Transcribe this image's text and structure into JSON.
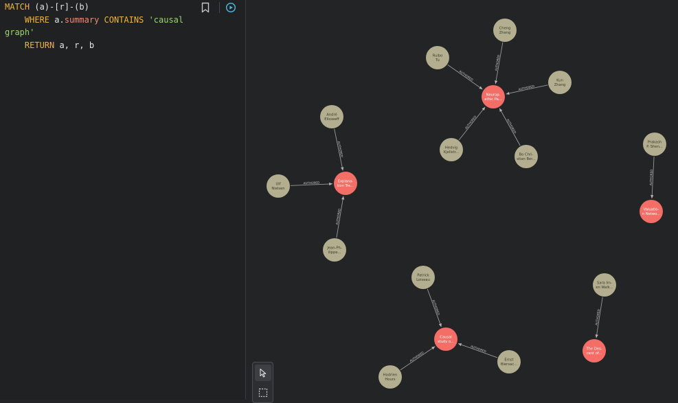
{
  "editor": {
    "query_lines": [
      [
        {
          "t": "kw",
          "v": "MATCH"
        },
        {
          "t": "txt",
          "v": " (a)-[r]-(b)"
        }
      ],
      [
        {
          "t": "txt",
          "v": "    "
        },
        {
          "t": "kw",
          "v": "WHERE"
        },
        {
          "t": "txt",
          "v": " a."
        },
        {
          "t": "prop",
          "v": "summary"
        },
        {
          "t": "txt",
          "v": " "
        },
        {
          "t": "kw",
          "v": "CONTAINS"
        },
        {
          "t": "txt",
          "v": " "
        },
        {
          "t": "str",
          "v": "'causal graph'"
        }
      ],
      [
        {
          "t": "txt",
          "v": "    "
        },
        {
          "t": "kw",
          "v": "RETURN"
        },
        {
          "t": "txt",
          "v": " a, r, b"
        }
      ]
    ],
    "buttons": [
      {
        "name": "bookmark-icon",
        "color": "#c8c8c8"
      },
      {
        "name": "run-query-icon",
        "color": "#4fb3d9"
      }
    ]
  },
  "graph": {
    "colors": {
      "author_fill": "#b3ae8f",
      "author_text": "#3a3a2c",
      "paper_fill": "#f26e66",
      "paper_text": "#ffffff",
      "edge": "#9a9a9a"
    },
    "relationship_label": "AUTHORED",
    "authors": [
      {
        "id": "cheng",
        "label": "Cheng\nZhang"
      },
      {
        "id": "ruibo",
        "label": "Ruibo\nTu"
      },
      {
        "id": "kun",
        "label": "Kun\nZhang"
      },
      {
        "id": "hedvig",
        "label": "Hedvig\nKjellstr..."
      },
      {
        "id": "bo",
        "label": "Bo Chri-\nstian Ber..."
      },
      {
        "id": "andre",
        "label": "André\nElisseeff"
      },
      {
        "id": "ulf",
        "label": "Ulf\nNielsen"
      },
      {
        "id": "jean",
        "label": "Jean-Ph-\nilippe..."
      },
      {
        "id": "prakash",
        "label": "Prakash\nP. Shen..."
      },
      {
        "id": "patrick",
        "label": "Patrick\nLoiseau"
      },
      {
        "id": "hadrien",
        "label": "Hadrien\nHours"
      },
      {
        "id": "ernst",
        "label": "Ernst\nBiersac..."
      },
      {
        "id": "sara",
        "label": "Sara Im-\nen Walk..."
      }
    ],
    "papers": [
      {
        "id": "neuropathic",
        "label": "Neurop-\nathic Pa..."
      },
      {
        "id": "explanation",
        "label": "Explana-\ntion Tre..."
      },
      {
        "id": "valuation",
        "label": "Valuatio-\nn Netwo..."
      },
      {
        "id": "causal",
        "label": "Causal\nstudy o..."
      },
      {
        "id": "descent",
        "label": "The Des-\ncent of..."
      }
    ],
    "relationships": [
      {
        "from": "cheng",
        "to": "neuropathic"
      },
      {
        "from": "ruibo",
        "to": "neuropathic"
      },
      {
        "from": "kun",
        "to": "neuropathic"
      },
      {
        "from": "hedvig",
        "to": "neuropathic"
      },
      {
        "from": "bo",
        "to": "neuropathic"
      },
      {
        "from": "andre",
        "to": "explanation"
      },
      {
        "from": "ulf",
        "to": "explanation"
      },
      {
        "from": "jean",
        "to": "explanation"
      },
      {
        "from": "prakash",
        "to": "valuation"
      },
      {
        "from": "patrick",
        "to": "causal"
      },
      {
        "from": "hadrien",
        "to": "causal"
      },
      {
        "from": "ernst",
        "to": "causal"
      },
      {
        "from": "sara",
        "to": "descent"
      }
    ]
  },
  "toolbar": {
    "tools": [
      {
        "name": "select-pointer-icon",
        "active": true
      },
      {
        "name": "box-select-icon",
        "active": false
      }
    ]
  }
}
